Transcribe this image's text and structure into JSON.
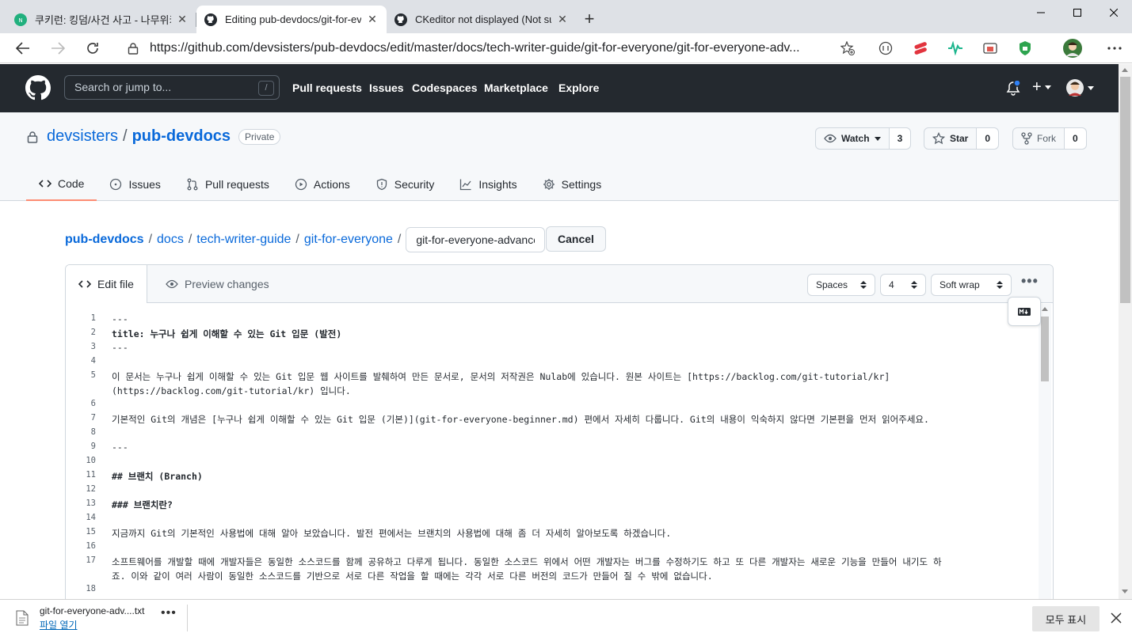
{
  "browser": {
    "tabs": [
      {
        "title": "쿠키런: 킹덤/사건 사고 - 나무위키",
        "close": "✕"
      },
      {
        "title": "Editing pub-devdocs/git-for-everyone",
        "close": "✕"
      },
      {
        "title": "CKeditor not displayed (Not sure",
        "close": "✕"
      }
    ],
    "new_tab": "+",
    "url": "https://github.com/devsisters/pub-devdocs/edit/master/docs/tech-writer-guide/git-for-everyone/git-for-everyone-adv..."
  },
  "github": {
    "search_placeholder": "Search or jump to...",
    "search_key": "/",
    "nav": [
      "Pull requests",
      "Issues",
      "Codespaces",
      "Marketplace",
      "Explore"
    ],
    "plus": "+"
  },
  "repo": {
    "owner": "devsisters",
    "separator": "/",
    "name": "pub-devdocs",
    "visibility": "Private",
    "watch": {
      "label": "Watch",
      "count": "3"
    },
    "star": {
      "label": "Star",
      "count": "0"
    },
    "fork": {
      "label": "Fork",
      "count": "0"
    },
    "tabs": [
      {
        "label": "Code",
        "icon": "code-icon"
      },
      {
        "label": "Issues",
        "icon": "issue-icon"
      },
      {
        "label": "Pull requests",
        "icon": "pull-request-icon"
      },
      {
        "label": "Actions",
        "icon": "play-icon"
      },
      {
        "label": "Security",
        "icon": "shield-icon"
      },
      {
        "label": "Insights",
        "icon": "graph-icon"
      },
      {
        "label": "Settings",
        "icon": "gear-icon"
      }
    ]
  },
  "breadcrumb": {
    "parts": [
      "pub-devdocs",
      "docs",
      "tech-writer-guide",
      "git-for-everyone"
    ],
    "separator": "/",
    "filename": "git-for-everyone-advanced.md",
    "cancel": "Cancel"
  },
  "editor": {
    "edit_tab": "Edit file",
    "preview_tab": "Preview changes",
    "indent_mode": "Spaces",
    "indent_size": "4",
    "wrap_mode": "Soft wrap",
    "more": "•••",
    "lines": [
      {
        "n": "1",
        "text": "---"
      },
      {
        "n": "2",
        "text": "title: 누구나 쉽게 이해할 수 있는 Git 입문 (발전)"
      },
      {
        "n": "3",
        "text": "---"
      },
      {
        "n": "4",
        "text": ""
      },
      {
        "n": "5",
        "text": "이 문서는 누구나 쉽게 이해할 수 있는 Git 입문 웹 사이트를 발췌하여 만든 문서로, 문서의 저작권은 Nulab에 있습니다. 원본 사이트는 [https://backlog.com/git-tutorial/kr]"
      },
      {
        "n": "",
        "text": "(https://backlog.com/git-tutorial/kr) 입니다."
      },
      {
        "n": "6",
        "text": ""
      },
      {
        "n": "7",
        "text": "기본적인 Git의 개념은 [누구나 쉽게 이해할 수 있는 Git 입문 (기본)](git-for-everyone-beginner.md) 편에서 자세히 다룹니다. Git의 내용이 익숙하지 않다면 기본편을 먼저 읽어주세요."
      },
      {
        "n": "8",
        "text": ""
      },
      {
        "n": "9",
        "text": "---"
      },
      {
        "n": "10",
        "text": ""
      },
      {
        "n": "11",
        "text": "## 브랜치 (Branch)"
      },
      {
        "n": "12",
        "text": ""
      },
      {
        "n": "13",
        "text": "### 브랜치란?"
      },
      {
        "n": "14",
        "text": ""
      },
      {
        "n": "15",
        "text": "지금까지 Git의 기본적인 사용법에 대해 알아 보았습니다. 발전 편에서는 브랜치의 사용법에 대해 좀 더 자세히 알아보도록 하겠습니다."
      },
      {
        "n": "16",
        "text": ""
      },
      {
        "n": "17",
        "text": "소프트웨어를 개발할 때에 개발자들은 동일한 소스코드를 함께 공유하고 다루게 됩니다. 동일한 소스코드 위에서 어떤 개발자는 버그를 수정하기도 하고 또 다른 개발자는 새로운 기능을 만들어 내기도 하"
      },
      {
        "n": "",
        "text": "죠. 이와 같이 여러 사람이 동일한 소스코드를 기반으로 서로 다른 작업을 할 때에는 각각 서로 다른 버전의 코드가 만들어 질 수 밖에 없습니다."
      },
      {
        "n": "18",
        "text": ""
      }
    ]
  },
  "download": {
    "filename": "git-for-everyone-adv....txt",
    "open": "파일 열기",
    "more": "•••",
    "show_all": "모두 표시"
  }
}
